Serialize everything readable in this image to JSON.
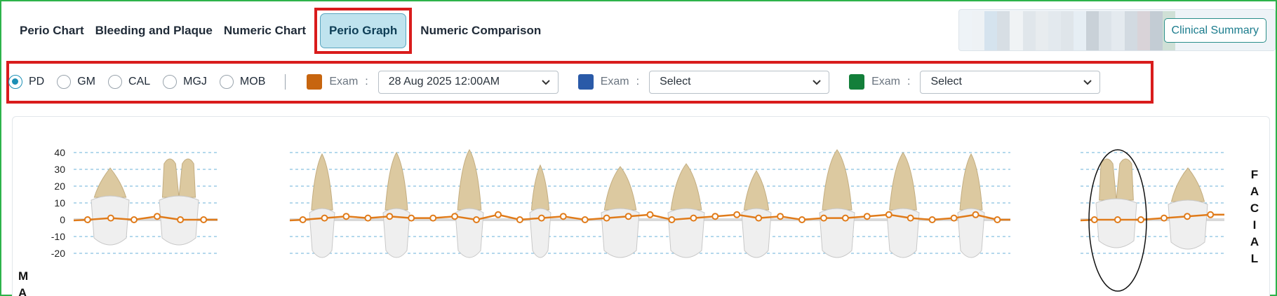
{
  "nav": {
    "tabs": [
      {
        "label": "Perio Chart"
      },
      {
        "label": "Bleeding and Plaque"
      },
      {
        "label": "Numeric Chart"
      },
      {
        "label": "Perio Graph",
        "active": true
      },
      {
        "label": "Numeric Comparison"
      }
    ],
    "clinical_summary_label": "Clinical Summary"
  },
  "controls": {
    "measures": [
      {
        "label": "PD",
        "checked": true
      },
      {
        "label": "GM",
        "checked": false
      },
      {
        "label": "CAL",
        "checked": false
      },
      {
        "label": "MGJ",
        "checked": false
      },
      {
        "label": "MOB",
        "checked": false
      }
    ],
    "exams": [
      {
        "label": "Exam",
        "color": "#c7650f",
        "value": "28 Aug 2025 12:00AM"
      },
      {
        "label": "Exam",
        "color": "#2a5aa8",
        "value": "Select"
      },
      {
        "label": "Exam",
        "color": "#137f3a",
        "value": "Select"
      }
    ]
  },
  "graph": {
    "side_label_right": "FACIAL",
    "side_label_left": "MA",
    "accent_line_color": "#e07b1a",
    "y_ticks": [
      "40",
      "30",
      "20",
      "10",
      "0",
      "-10",
      "-20"
    ]
  },
  "chart_data": {
    "type": "line",
    "series": [
      {
        "color": "#e07b1a",
        "segments": [
          {
            "tooth_group": "left",
            "values": [
              0,
              1,
              0,
              2,
              0,
              0
            ]
          },
          {
            "tooth_group": "middle",
            "values": [
              0,
              1,
              2,
              1,
              2,
              1,
              1,
              2,
              0,
              3,
              0,
              1,
              2,
              0,
              1,
              2,
              3,
              0,
              1,
              2,
              3,
              1,
              2,
              0,
              1,
              1,
              2,
              3,
              1,
              0,
              1,
              3,
              0
            ]
          },
          {
            "tooth_group": "right",
            "values": [
              0,
              0,
              0,
              1,
              2,
              3
            ]
          }
        ]
      }
    ],
    "ylim": [
      -20,
      40
    ]
  }
}
